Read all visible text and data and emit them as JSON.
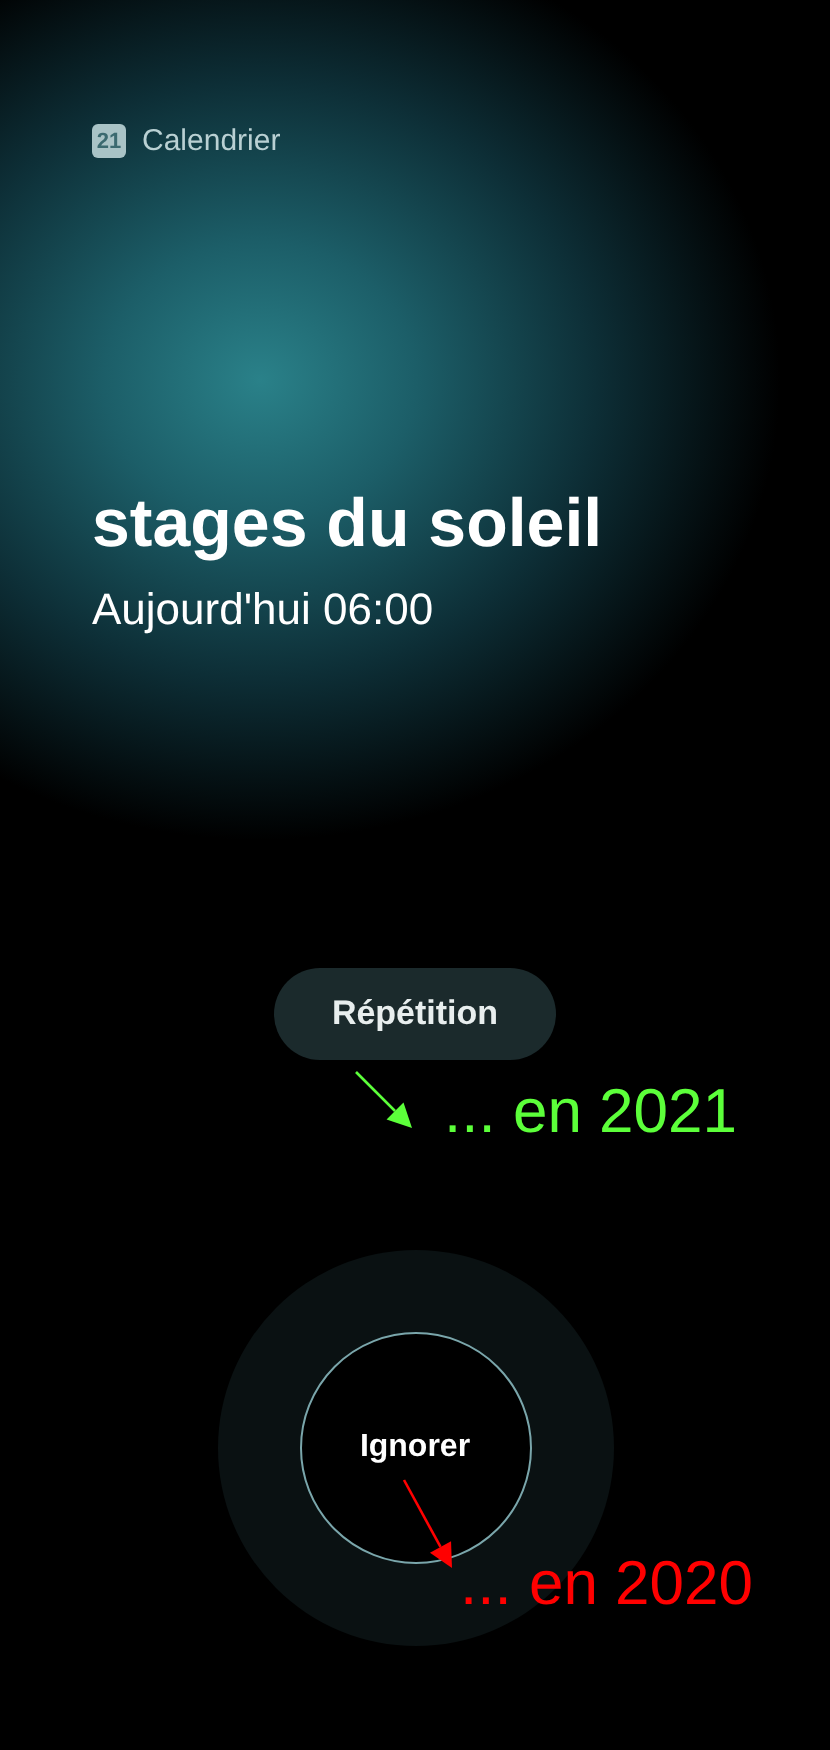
{
  "app": {
    "icon_text": "21",
    "name": "Calendrier"
  },
  "event": {
    "title": "stages du soleil",
    "time": "Aujourd'hui 06:00"
  },
  "snooze_button": {
    "label": "Répétition"
  },
  "dismiss_button": {
    "label": "Ignorer"
  },
  "annotations": [
    {
      "text": "... en 2021",
      "color": "#5cff3a"
    },
    {
      "text": "... en 2020",
      "color": "#ff0000"
    }
  ]
}
